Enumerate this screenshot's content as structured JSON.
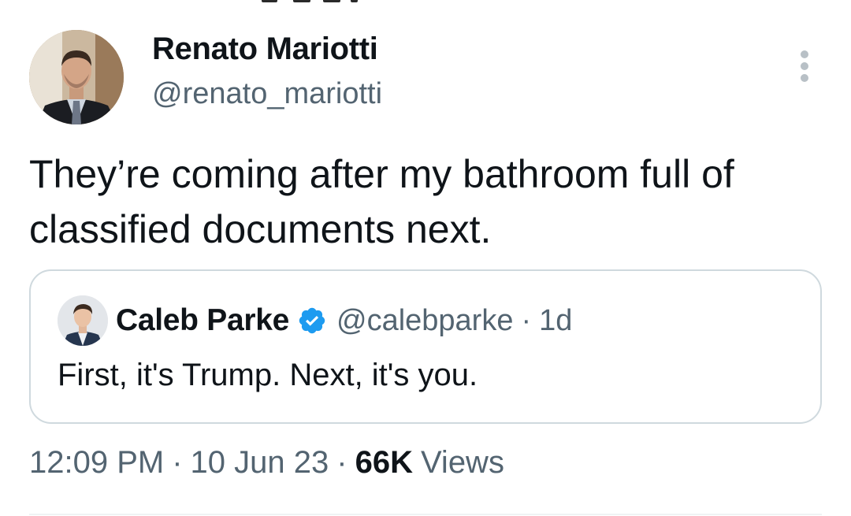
{
  "tweet": {
    "author": {
      "name": "Renato Mariotti",
      "handle": "@renato_mariotti"
    },
    "text_lines": [
      "They’re coming after my bathroom full of",
      "classified documents next."
    ],
    "timestamp": "12:09 PM",
    "date": "10 Jun 23",
    "separator": "·",
    "views_count": "66K",
    "views_label": "Views"
  },
  "quoted_tweet": {
    "author": {
      "name": "Caleb Parke",
      "handle": "@calebparke",
      "verified": true
    },
    "separator": "·",
    "time": "1d",
    "text": "First, it's Trump. Next, it's you."
  },
  "colors": {
    "text_primary": "#0f1419",
    "text_secondary": "#536471",
    "verified_blue": "#1d9bf0",
    "border": "#cfd9de"
  },
  "icons": {
    "more": "more-vertical-icon",
    "verified": "verified-badge-icon"
  }
}
